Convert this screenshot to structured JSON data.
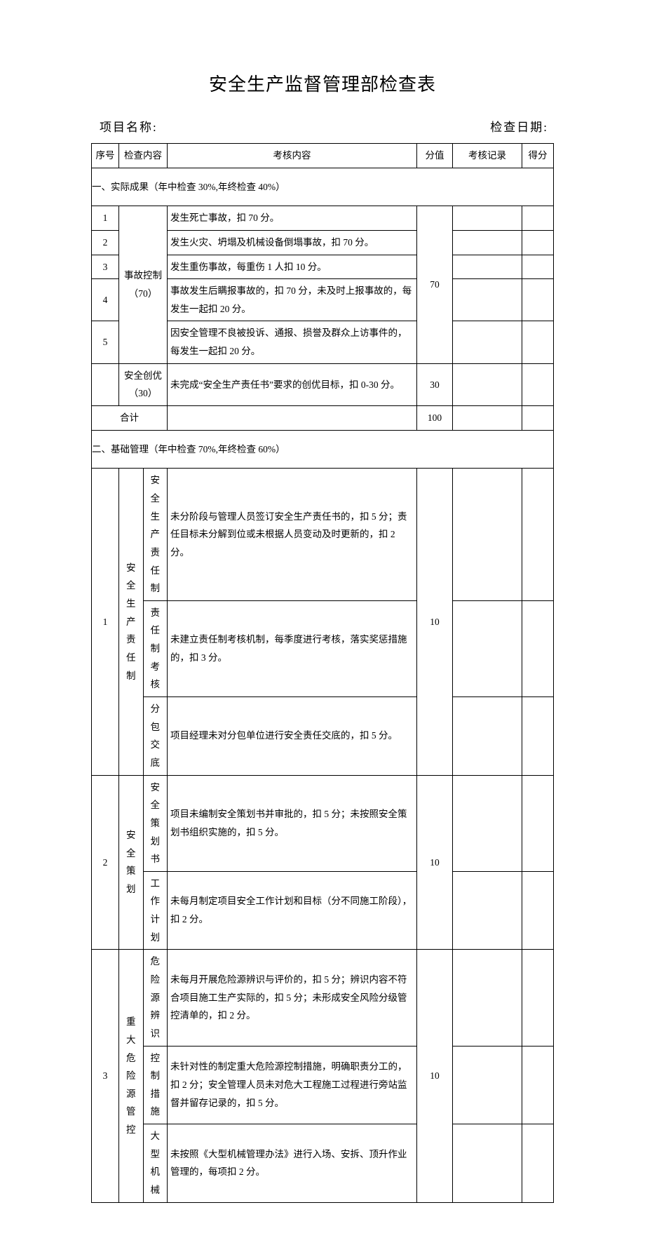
{
  "title": "安全生产监督管理部检查表",
  "meta": {
    "project_label": "项目名称:",
    "date_label": "检查日期:"
  },
  "headers": {
    "idx": "序号",
    "category": "检查内容",
    "desc": "考核内容",
    "score": "分值",
    "record": "考核记录",
    "got": "得分"
  },
  "section1": {
    "heading": "一、实际成果（年中检查 30%,年终检查 40%）",
    "accident": {
      "label_line1": "事故控制",
      "label_line2": "（70）",
      "score": "70",
      "rows": [
        {
          "idx": "1",
          "desc": "发生死亡事故，扣 70 分。"
        },
        {
          "idx": "2",
          "desc": "发生火灾、坍塌及机械设备倒塌事故，扣 70 分。"
        },
        {
          "idx": "3",
          "desc": "发生重伤事故，每重伤 1 人扣 10 分。"
        },
        {
          "idx": "4",
          "desc": "事故发生后瞒报事故的，扣 70 分，未及时上报事故的，每发生一起扣 20 分。"
        },
        {
          "idx": "5",
          "desc": "因安全管理不良被投诉、通报、损誉及群众上访事件的，每发生一起扣 20 分。"
        }
      ]
    },
    "excellence": {
      "label_line1": "安全创优",
      "label_line2": "（30）",
      "desc": "未完成“安全生产责任书”要求的创优目标，扣 0-30 分。",
      "score": "30"
    },
    "total": {
      "label": "合计",
      "score": "100"
    }
  },
  "section2": {
    "heading": "二、基础管理（年中检查 70%,年终检查 60%）",
    "groups": [
      {
        "idx": "1",
        "category": "安全生产责任制",
        "score": "10",
        "subs": [
          {
            "sub": "安全生产责任制",
            "desc": "未分阶段与管理人员签订安全生产责任书的，扣 5 分；责任目标未分解到位或未根据人员变动及时更新的，扣 2 分。"
          },
          {
            "sub": "责任制考核",
            "desc": "未建立责任制考核机制，每季度进行考核，落实奖惩措施的，扣 3 分。"
          },
          {
            "sub": "分包交底",
            "desc": "项目经理未对分包单位进行安全责任交底的，扣 5 分。"
          }
        ]
      },
      {
        "idx": "2",
        "category": "安全策划",
        "score": "10",
        "subs": [
          {
            "sub": "安全策划书",
            "desc": "项目未编制安全策划书并审批的，扣 5 分；未按照安全策划书组织实施的，扣 5 分。"
          },
          {
            "sub": "工作计划",
            "desc": "未每月制定项目安全工作计划和目标（分不同施工阶段），扣 2 分。"
          }
        ]
      },
      {
        "idx": "3",
        "category": "重大危险源管控",
        "score": "10",
        "subs": [
          {
            "sub": "危险源辨识",
            "desc": "未每月开展危险源辨识与评价的，扣 5 分；辨识内容不符合项目施工生产实际的，扣 5 分；未形成安全风险分级管控清单的，扣 2 分。"
          },
          {
            "sub": "控制措施",
            "desc": "未针对性的制定重大危险源控制措施，明确职责分工的，扣 2 分；安全管理人员未对危大工程施工过程进行旁站监督并留存记录的，扣 5 分。"
          },
          {
            "sub": "大型机械",
            "desc": "未按照《大型机械管理办法》进行入场、安拆、顶升作业管理的，每项扣 2 分。"
          }
        ]
      }
    ]
  }
}
